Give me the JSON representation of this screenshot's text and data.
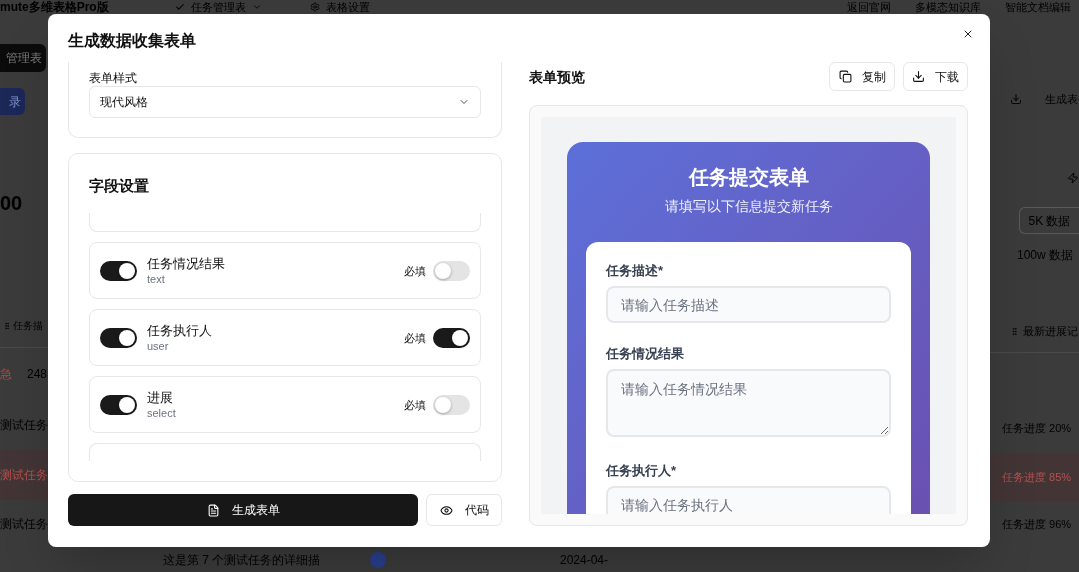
{
  "page": {
    "app_title": "mute多维表格Pro版",
    "nav_tabs": [
      {
        "kind": "dropdown",
        "label": "任务管理表"
      },
      {
        "kind": "settings",
        "label": "表格设置"
      }
    ],
    "nav_links": [
      "返回官网",
      "多模态知识库",
      "智能文档编辑"
    ],
    "table_button": "管理表",
    "record_button": "录",
    "stat_value": "00",
    "left_column_header": "任务描",
    "priority_tag": "急",
    "id_cell": "248",
    "export_button": "生成表",
    "data_buttons": [
      "5K 数据",
      "100w 数据"
    ],
    "right_column_header": "最新进展记",
    "rows": [
      {
        "title": "测试任务",
        "progress": "任务进度 20%",
        "urgent": false
      },
      {
        "title": "测试任务",
        "progress": "任务进度 85%",
        "urgent": true
      },
      {
        "title": "测试任务",
        "progress": "任务进度 96%",
        "urgent": false
      }
    ],
    "bottom_row": {
      "description": "这是第 7 个测试任务的详细描",
      "date": "2024-04-"
    }
  },
  "dialog": {
    "title": "生成数据收集表单",
    "style_section": {
      "label": "表单样式",
      "value": "现代风格"
    },
    "fields_section": {
      "title": "字段设置",
      "fields": [
        {
          "name": "任务情况结果",
          "type": "text",
          "enabled": true,
          "required_label": "必填",
          "required": false
        },
        {
          "name": "任务执行人",
          "type": "user",
          "enabled": true,
          "required_label": "必填",
          "required": true
        },
        {
          "name": "进展",
          "type": "select",
          "enabled": true,
          "required_label": "必填",
          "required": false
        }
      ]
    },
    "generate_button": "生成表单",
    "code_button": "代码",
    "preview": {
      "title": "表单预览",
      "copy_button": "复制",
      "download_button": "下载",
      "form": {
        "title": "任务提交表单",
        "subtitle": "请填写以下信息提交新任务",
        "fields": [
          {
            "kind": "input",
            "label": "任务描述*",
            "placeholder": "请输入任务描述"
          },
          {
            "kind": "textarea",
            "label": "任务情况结果",
            "placeholder": "请输入任务情况结果"
          },
          {
            "kind": "input",
            "label": "任务执行人*",
            "placeholder": "请输入任务执行人"
          }
        ]
      }
    }
  }
}
